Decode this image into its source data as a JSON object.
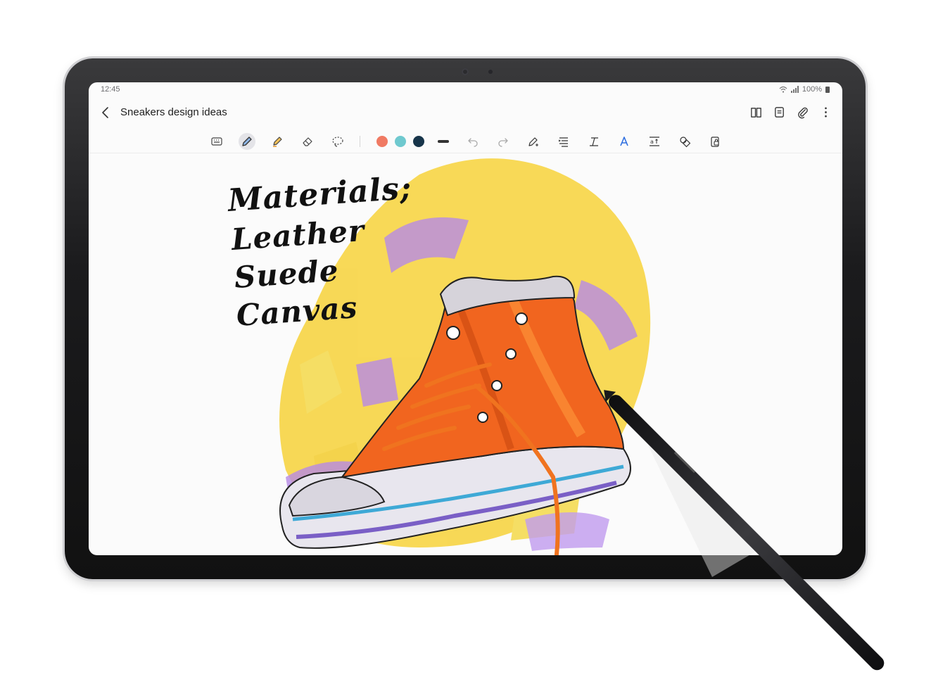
{
  "status": {
    "time": "12:45",
    "battery": "100%"
  },
  "note": {
    "title": "Sneakers design ideas"
  },
  "appbar_icons": [
    "book-view-icon",
    "page-icon",
    "attach-icon",
    "more-icon"
  ],
  "toolbar": {
    "tools": [
      "keyboard-icon",
      "pen-icon",
      "highlighter-icon",
      "eraser-icon",
      "lasso-icon",
      "undo-icon",
      "redo-icon",
      "pen-settings-icon",
      "text-align-icon",
      "text-style-icon",
      "ai-text-icon",
      "text-box-icon",
      "shapes-icon",
      "lock-icon"
    ],
    "colors": [
      "#f07a63",
      "#6fc9cf",
      "#17354a"
    ]
  },
  "handwriting": {
    "line1": "Materials;",
    "line2": "Leather",
    "line3": "Suede",
    "line4": "Canvas"
  }
}
